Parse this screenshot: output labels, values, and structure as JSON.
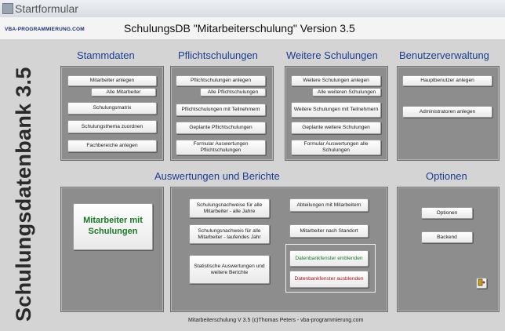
{
  "window": {
    "title": "Startformular"
  },
  "header": {
    "logo": "VBA-PROGRAMMIERUNG.COM",
    "title": "SchulungsDB \"Mitarbeiterschulung\" Version 3.5"
  },
  "side_label": "Schulungsdatenbank 3.5",
  "sections": {
    "stammdaten": {
      "title": "Stammdaten",
      "buttons": [
        "Mitarbeiter anlegen",
        "Alle Mitarbeiter",
        "Schulungsmatrix",
        "Schulungsthema zuordnen",
        "Fachbereiche anlegen"
      ]
    },
    "pflicht": {
      "title": "Pflichtschulungen",
      "buttons": [
        "Pflichtschulungen anlegen",
        "Alle Pflichtschulungen",
        "Pflichtschulungen mit Teilnehmern",
        "Geplante Pflichtschulungen",
        "Formular Auswertungen Pflichtschulungen"
      ]
    },
    "weitere": {
      "title": "Weitere Schulungen",
      "buttons": [
        "Weitere Schulungen anlegen",
        "Alle weiteren Schulungen",
        "Weitere Schulungen mit Teilnehmern",
        "Geplante weitere Schulungen",
        "Formular Auswertungen alle Schulungen"
      ]
    },
    "benutzer": {
      "title": "Benutzerverwaltung",
      "buttons": [
        "Hauptbenutzer anlegen",
        "Administratoren anlegen"
      ]
    },
    "auswertungen": {
      "title": "Auswertungen und Berichte",
      "big_button": "Mitarbeiter mit Schulungen",
      "buttons": [
        "Schulungsnachweise für alle Mitarbeiter - alle Jahre",
        "Schulungsnachweis für alle Mitarbeiter - laufendes Jahr",
        "Statistische Auswertungen und weitere Berichte",
        "Abteilungen mit Mitarbeitern",
        "Mitarbeiter nach Standort",
        "Datenbankfenster einblenden",
        "Datenbankfenster ausblenden"
      ]
    },
    "optionen": {
      "title": "Optionen",
      "buttons": [
        "Optionen",
        "Backend"
      ],
      "exit_icon": "exit-door-icon"
    }
  },
  "footer": "Mitarbeiterschulung V 3.5 (c)Thomas Peters - vba-programmierung.com",
  "colors": {
    "heading": "#1c3d92",
    "panel": "#8d8d8d",
    "green_text": "#1a7a2a",
    "red_text": "#b01818"
  }
}
